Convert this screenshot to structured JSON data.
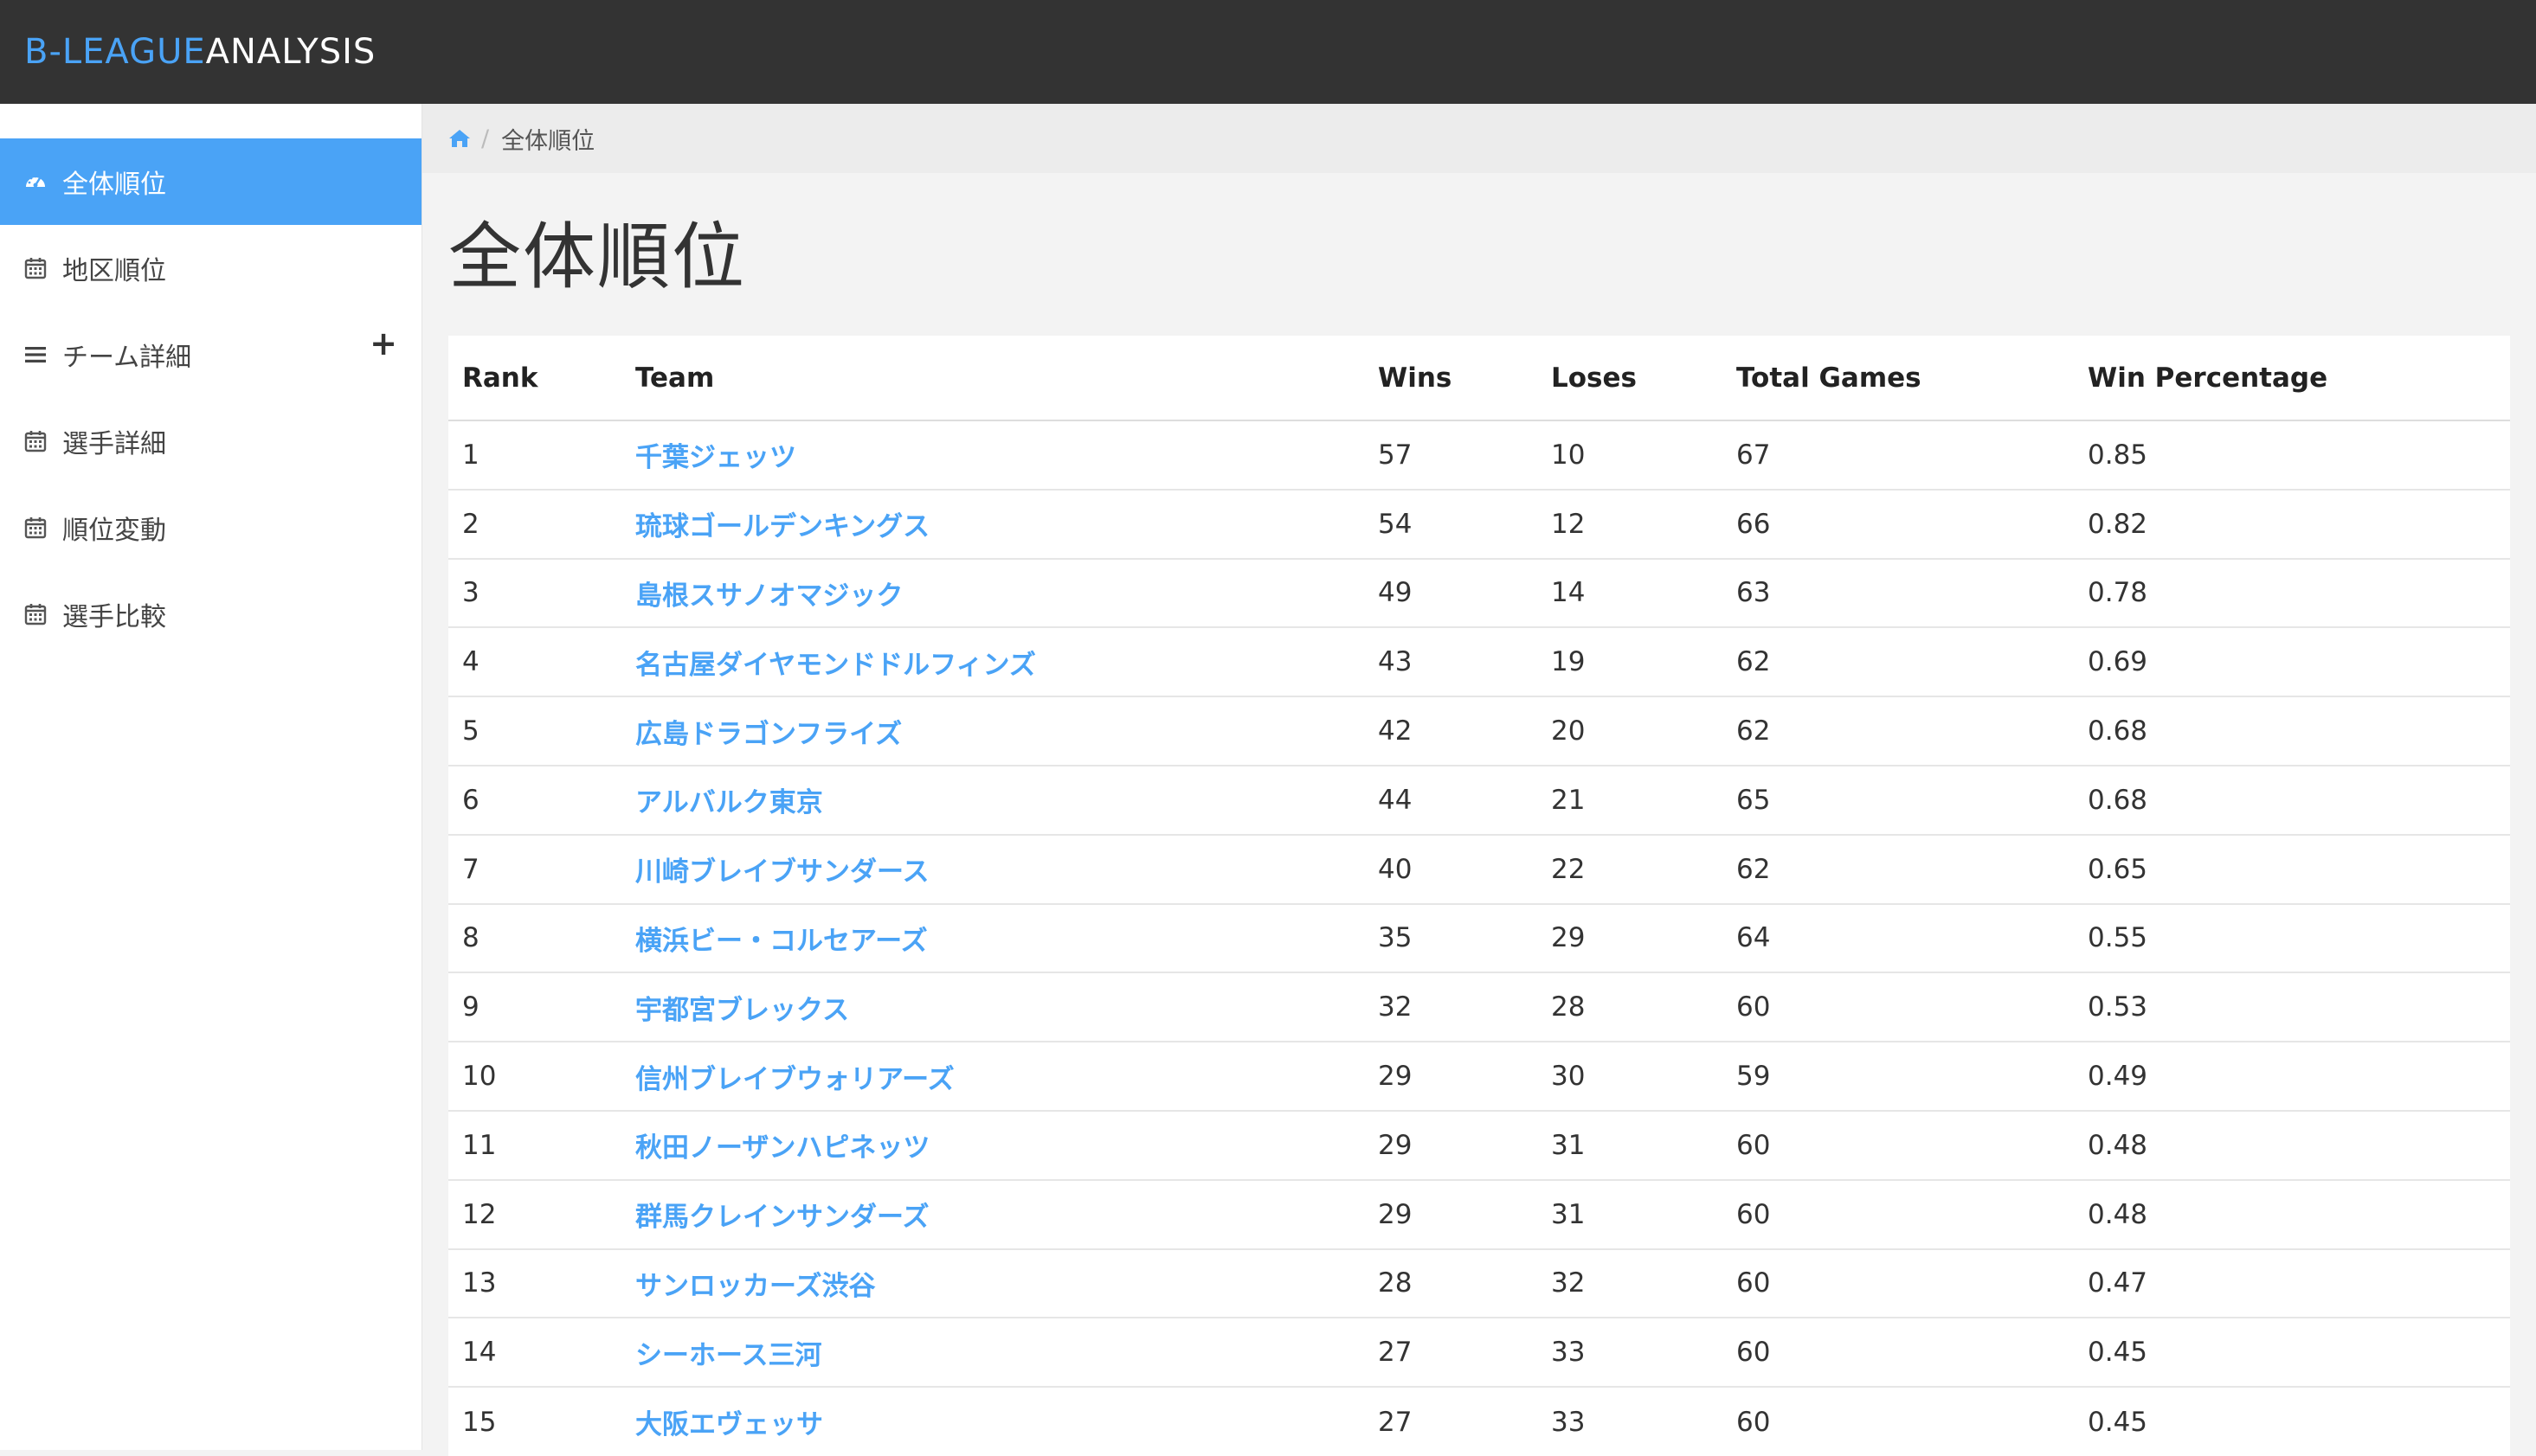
{
  "brand": {
    "part1": "B-LEAGUE",
    "part2": "ANALYSIS"
  },
  "colors": {
    "accent": "#4aa3f6",
    "navbar": "#333333"
  },
  "sidebar": {
    "items": [
      {
        "label": "全体順位",
        "icon": "dashboard-icon",
        "active": true
      },
      {
        "label": "地区順位",
        "icon": "calendar-icon",
        "active": false
      },
      {
        "label": "チーム詳細",
        "icon": "bars-icon",
        "active": false,
        "expand": "+"
      },
      {
        "label": "選手詳細",
        "icon": "calendar-icon",
        "active": false
      },
      {
        "label": "順位変動",
        "icon": "calendar-icon",
        "active": false
      },
      {
        "label": "選手比較",
        "icon": "calendar-icon",
        "active": false
      }
    ]
  },
  "breadcrumb": {
    "home_icon": "home-icon",
    "separator": "/",
    "current": "全体順位"
  },
  "page": {
    "title": "全体順位"
  },
  "table": {
    "headers": [
      "Rank",
      "Team",
      "Wins",
      "Loses",
      "Total Games",
      "Win Percentage"
    ],
    "rows": [
      [
        "1",
        "千葉ジェッツ",
        "57",
        "10",
        "67",
        "0.85"
      ],
      [
        "2",
        "琉球ゴールデンキングス",
        "54",
        "12",
        "66",
        "0.82"
      ],
      [
        "3",
        "島根スサノオマジック",
        "49",
        "14",
        "63",
        "0.78"
      ],
      [
        "4",
        "名古屋ダイヤモンドドルフィンズ",
        "43",
        "19",
        "62",
        "0.69"
      ],
      [
        "5",
        "広島ドラゴンフライズ",
        "42",
        "20",
        "62",
        "0.68"
      ],
      [
        "6",
        "アルバルク東京",
        "44",
        "21",
        "65",
        "0.68"
      ],
      [
        "7",
        "川崎ブレイブサンダース",
        "40",
        "22",
        "62",
        "0.65"
      ],
      [
        "8",
        "横浜ビー・コルセアーズ",
        "35",
        "29",
        "64",
        "0.55"
      ],
      [
        "9",
        "宇都宮ブレックス",
        "32",
        "28",
        "60",
        "0.53"
      ],
      [
        "10",
        "信州ブレイブウォリアーズ",
        "29",
        "30",
        "59",
        "0.49"
      ],
      [
        "11",
        "秋田ノーザンハピネッツ",
        "29",
        "31",
        "60",
        "0.48"
      ],
      [
        "12",
        "群馬クレインサンダーズ",
        "29",
        "31",
        "60",
        "0.48"
      ],
      [
        "13",
        "サンロッカーズ渋谷",
        "28",
        "32",
        "60",
        "0.47"
      ],
      [
        "14",
        "シーホース三河",
        "27",
        "33",
        "60",
        "0.45"
      ],
      [
        "15",
        "大阪エヴェッサ",
        "27",
        "33",
        "60",
        "0.45"
      ]
    ]
  }
}
